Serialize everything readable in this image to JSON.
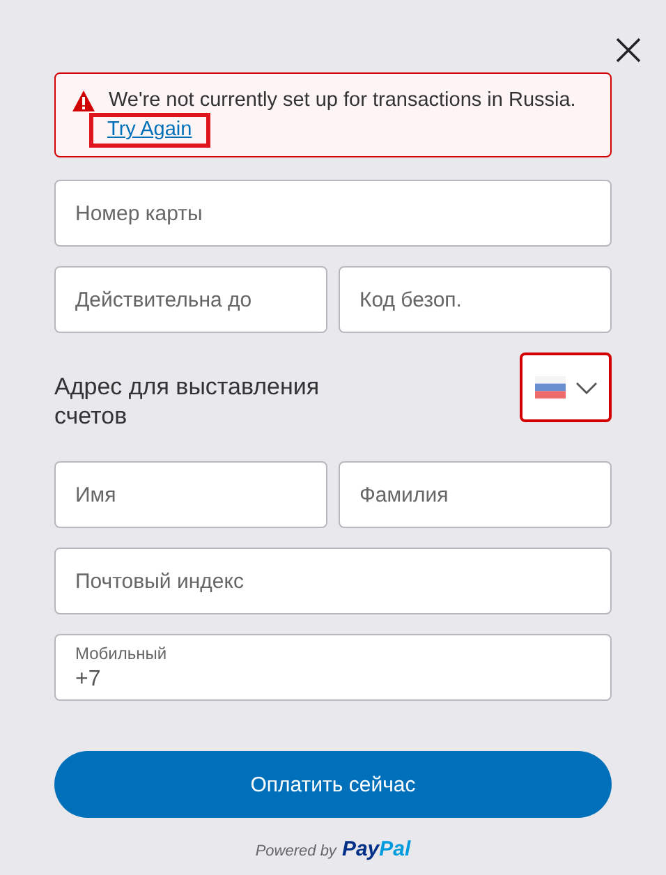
{
  "alert": {
    "message": "We're not currently set up for transactions in Russia.",
    "link": {
      "label": "Try Again",
      "highlighted": true
    }
  },
  "rows": [
    {
      "fields": [
        {
          "placeholder": "Номер карты"
        }
      ]
    },
    {
      "fields": [
        {
          "placeholder": "Действительна до"
        },
        {
          "placeholder": "Код безоп."
        }
      ]
    }
  ],
  "billing": {
    "title": "Адрес для выставления счетов",
    "country_selector": {
      "highlighted": true
    }
  },
  "rows2": [
    {
      "fields": [
        {
          "placeholder": "Имя"
        },
        {
          "placeholder": "Фамилия"
        }
      ]
    },
    {
      "fields": [
        {
          "placeholder": "Почтовый индекс"
        }
      ]
    },
    {
      "fields": [
        {
          "label": "Мобильный",
          "value": "+7"
        }
      ]
    }
  ],
  "pay_button": {
    "label": "Оплатить сейчас"
  },
  "footer": {
    "text": "Powered by",
    "logo": [
      "Pay",
      "Pal"
    ]
  }
}
